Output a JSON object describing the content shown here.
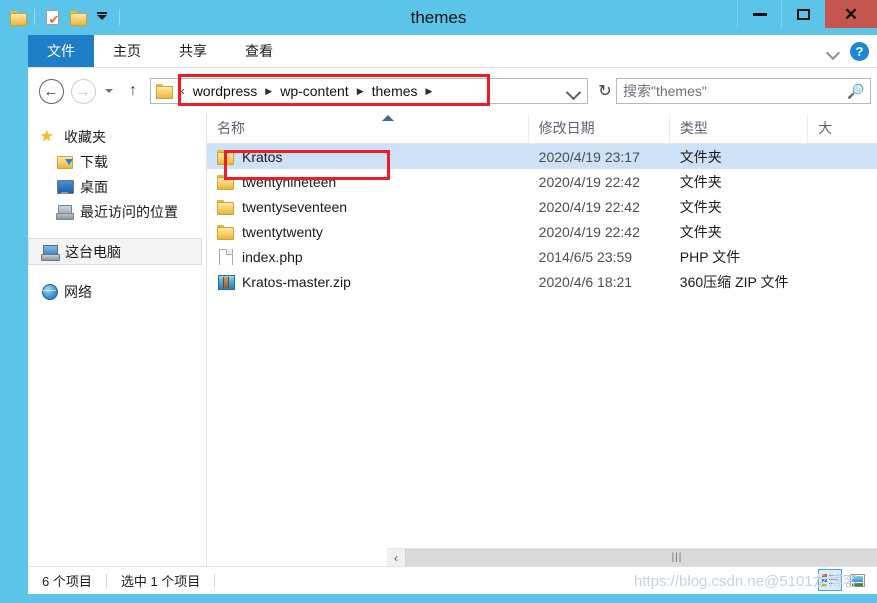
{
  "window": {
    "title": "themes",
    "controls": {
      "minimize": "minimize",
      "maximize": "maximize",
      "close": "✕"
    },
    "accent_color": "#5bc4e8",
    "close_color": "#c4564f"
  },
  "quick_access": {
    "items": [
      {
        "name": "folder-icon",
        "label": ""
      },
      {
        "name": "properties-icon",
        "label": ""
      },
      {
        "name": "new-folder-icon",
        "label": ""
      },
      {
        "name": "customize-caret-icon",
        "label": ""
      }
    ]
  },
  "ribbon": {
    "tabs": [
      {
        "label": "文件",
        "active": true
      },
      {
        "label": "主页",
        "active": false
      },
      {
        "label": "共享",
        "active": false
      },
      {
        "label": "查看",
        "active": false
      }
    ],
    "active_tab_color": "#1e7ec8",
    "expand_icon": "chevron-down-icon",
    "help_label": "?"
  },
  "address_bar": {
    "back": "←",
    "forward": "→",
    "recent_caret": "▾",
    "up": "↑",
    "root_ellipsis": "«",
    "breadcrumbs": [
      {
        "label": "wordpress"
      },
      {
        "label": "wp-content"
      },
      {
        "label": "themes"
      }
    ],
    "separator": "▶",
    "history_caret": "⌄",
    "refresh": "↻"
  },
  "search": {
    "placeholder": "搜索\"themes\"",
    "icon": "search-icon"
  },
  "nav_pane": {
    "items": [
      {
        "label": "收藏夹",
        "icon": "star-icon",
        "indent": false,
        "selected": false
      },
      {
        "label": "下载",
        "icon": "downloads-folder-icon",
        "indent": true,
        "selected": false
      },
      {
        "label": "桌面",
        "icon": "desktop-icon",
        "indent": true,
        "selected": false
      },
      {
        "label": "最近访问的位置",
        "icon": "recent-places-icon",
        "indent": true,
        "selected": false
      },
      {
        "label": "这台电脑",
        "icon": "this-pc-icon",
        "indent": false,
        "selected": true
      },
      {
        "label": "网络",
        "icon": "network-icon",
        "indent": false,
        "selected": false
      }
    ]
  },
  "file_list": {
    "columns": [
      {
        "label": "名称",
        "key": "name",
        "sorted": "asc"
      },
      {
        "label": "修改日期",
        "key": "date"
      },
      {
        "label": "类型",
        "key": "type"
      },
      {
        "label": "大",
        "key": "size"
      }
    ],
    "rows": [
      {
        "name": "Kratos",
        "date": "2020/4/19 23:17",
        "type": "文件夹",
        "size": "",
        "icon": "folder-icon",
        "selected": true
      },
      {
        "name": "twentynineteen",
        "date": "2020/4/19 22:42",
        "type": "文件夹",
        "size": "",
        "icon": "folder-icon",
        "selected": false
      },
      {
        "name": "twentyseventeen",
        "date": "2020/4/19 22:42",
        "type": "文件夹",
        "size": "",
        "icon": "folder-icon",
        "selected": false
      },
      {
        "name": "twentytwenty",
        "date": "2020/4/19 22:42",
        "type": "文件夹",
        "size": "",
        "icon": "folder-icon",
        "selected": false
      },
      {
        "name": "index.php",
        "date": "2014/6/5 23:59",
        "type": "PHP 文件",
        "size": "",
        "icon": "php-file-icon",
        "selected": false
      },
      {
        "name": "Kratos-master.zip",
        "date": "2020/4/6 18:21",
        "type": "360压缩 ZIP 文件",
        "size": "",
        "icon": "zip-file-icon",
        "selected": false
      }
    ]
  },
  "scrollbar": {
    "left_arrow": "‹",
    "right_arrow": "›",
    "grip": "|||"
  },
  "status_bar": {
    "item_count": "6 个项目",
    "selection": "选中 1 个项目",
    "view_buttons": [
      {
        "name": "details-view-button",
        "active": true
      },
      {
        "name": "large-icons-view-button",
        "active": false
      }
    ]
  },
  "annotations": {
    "highlight_color": "#ee1c25",
    "boxes": [
      {
        "name": "breadcrumb-highlight"
      },
      {
        "name": "kratos-row-highlight"
      }
    ]
  },
  "watermark": {
    "text": "https://blog.csdn.ne@5101龙博客"
  }
}
